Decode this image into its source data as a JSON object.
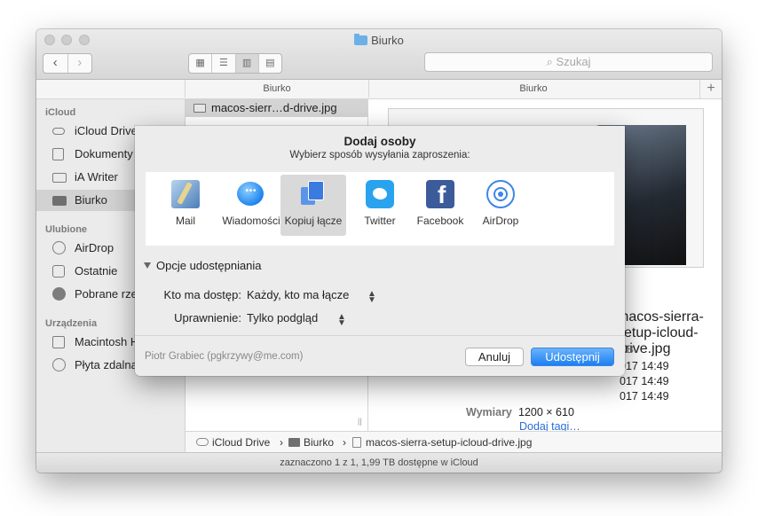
{
  "window": {
    "title": "Biurko",
    "search_placeholder": "Szukaj",
    "nav_back": "‹",
    "nav_forward": "›",
    "view_icons": [
      "▦",
      "☰",
      "▥",
      "▤"
    ],
    "column_header_1": "Biurko",
    "column_header_2": "Biurko",
    "plus": "+"
  },
  "sidebar": {
    "sections": [
      {
        "title": "iCloud",
        "items": [
          {
            "label": "iCloud Drive",
            "icon": "cloud-icon"
          },
          {
            "label": "Dokumenty",
            "icon": "document-icon"
          },
          {
            "label": "iA Writer",
            "icon": "folder-icon"
          },
          {
            "label": "Biurko",
            "icon": "desktop-icon",
            "selected": true
          }
        ]
      },
      {
        "title": "Ulubione",
        "items": [
          {
            "label": "AirDrop",
            "icon": "airdrop-icon"
          },
          {
            "label": "Ostatnie",
            "icon": "recents-icon"
          },
          {
            "label": "Pobrane rzeczy",
            "icon": "downloads-icon"
          }
        ]
      },
      {
        "title": "Urządzenia",
        "items": [
          {
            "label": "Macintosh HD",
            "icon": "harddisk-icon"
          },
          {
            "label": "Płyta zdalna",
            "icon": "disc-icon"
          }
        ]
      }
    ]
  },
  "files": {
    "selected_name": "macos-sierr…d-drive.jpg"
  },
  "preview": {
    "name": "macos-sierra-setup-icloud-drive.jpg",
    "size": "KB",
    "dates": [
      "017 14:49",
      "017 14:49",
      "017 14:49"
    ],
    "dimensions_label": "Wymiary",
    "dimensions_value": "1200 × 610",
    "add_tags": "Dodaj tagi…"
  },
  "pathbar": {
    "segments": [
      "iCloud Drive",
      "Biurko",
      "macos-sierra-setup-icloud-drive.jpg"
    ],
    "separator": "›"
  },
  "status": {
    "text": "zaznaczono 1 z 1, 1,99 TB dostępne w iCloud"
  },
  "sheet": {
    "title": "Dodaj osoby",
    "subtitle": "Wybierz sposób wysyłania zaproszenia:",
    "apps": [
      {
        "label": "Mail",
        "icon": "mail-icon"
      },
      {
        "label": "Wiadomości",
        "icon": "messages-icon"
      },
      {
        "label": "Kopiuj łącze",
        "icon": "copy-link-icon",
        "selected": true
      },
      {
        "label": "Twitter",
        "icon": "twitter-icon"
      },
      {
        "label": "Facebook",
        "icon": "facebook-icon"
      },
      {
        "label": "AirDrop",
        "icon": "airdrop-icon"
      }
    ],
    "options_title": "Opcje udostępniania",
    "access_label": "Kto ma dostęp:",
    "access_value": "Każdy, kto ma łącze",
    "permission_label": "Uprawnienie:",
    "permission_value": "Tylko podgląd",
    "account": "Piotr Grabiec (pgkrzywy@me.com)",
    "cancel": "Anuluj",
    "share": "Udostępnij"
  },
  "colors": {
    "accent": "#1b7ff2",
    "link": "#2a6fd6",
    "selection": "#d2d2d2"
  }
}
